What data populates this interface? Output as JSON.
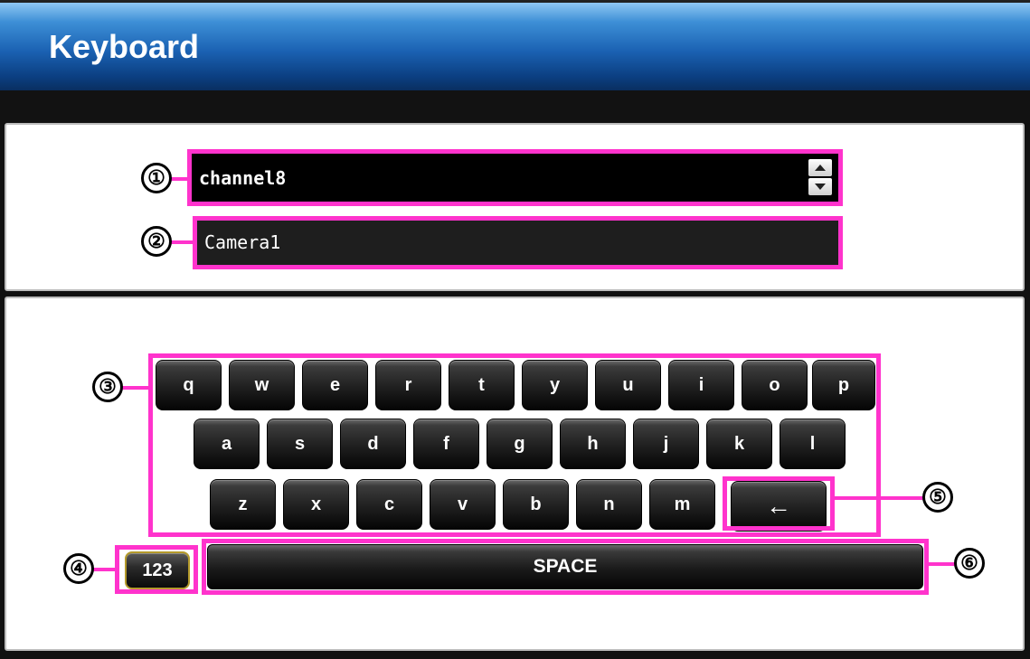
{
  "header": {
    "title": "Keyboard"
  },
  "fields": {
    "field1_value": "channel8",
    "field2_value": "Camera1"
  },
  "keyboard": {
    "row1": [
      "q",
      "w",
      "e",
      "r",
      "t",
      "y",
      "u",
      "i",
      "o",
      "p"
    ],
    "row2": [
      "a",
      "s",
      "d",
      "f",
      "g",
      "h",
      "j",
      "k",
      "l"
    ],
    "row3": [
      "z",
      "x",
      "c",
      "v",
      "b",
      "n",
      "m"
    ],
    "backspace": "←",
    "numeric_toggle": "123",
    "space": "SPACE"
  },
  "callouts": [
    "①",
    "②",
    "③",
    "④",
    "⑤",
    "⑥"
  ],
  "icons": {
    "spinner": "up-down-arrows-icon",
    "backspace": "arrow-left-icon"
  },
  "colors": {
    "highlight": "#ff33cc",
    "title_bar": "#1b62b3",
    "numeric_toggle_border": "#b49a2b"
  }
}
